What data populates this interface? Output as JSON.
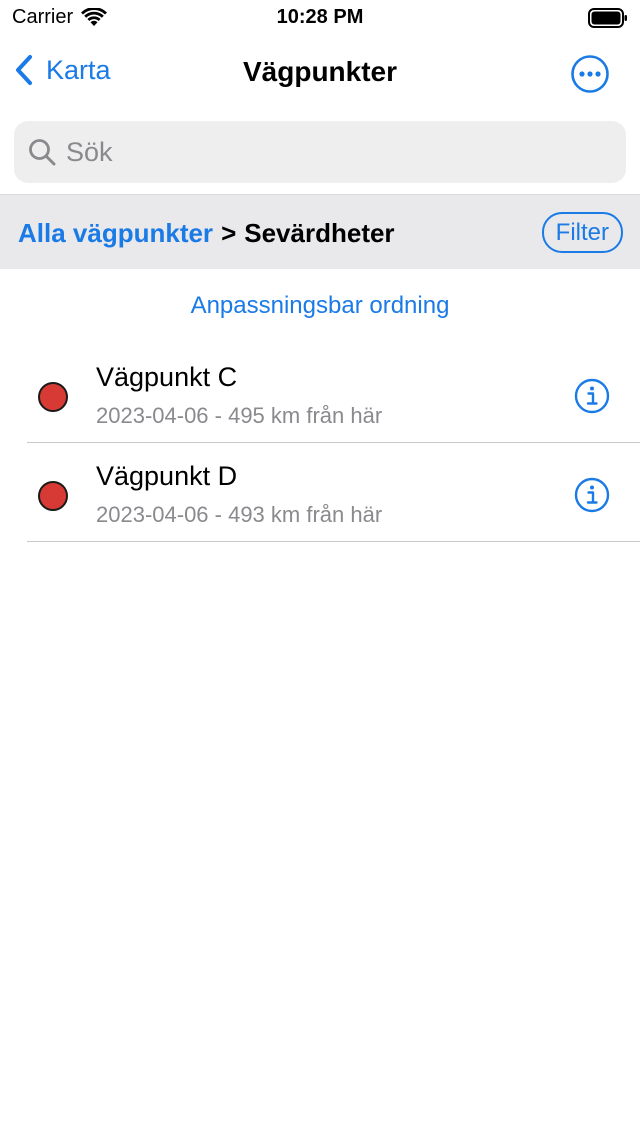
{
  "status_bar": {
    "carrier": "Carrier",
    "time": "10:28 PM",
    "icons": [
      "wifi-icon",
      "battery-icon"
    ]
  },
  "nav": {
    "back_label": "Karta",
    "title": "Vägpunkter",
    "more_icon": "ellipsis-circle-icon"
  },
  "search": {
    "placeholder": "Sök",
    "value": ""
  },
  "filter_bar": {
    "breadcrumb_link": "Alla vägpunkter",
    "separator": ">",
    "current": "Sevärdheter",
    "filter_label": "Filter"
  },
  "sort_order_label": "Anpassningsbar ordning",
  "waypoints": [
    {
      "name": "Vägpunkt C",
      "detail": "2023-04-06 - 495 km från här",
      "color": "#d73a35"
    },
    {
      "name": "Vägpunkt D",
      "detail": "2023-04-06 - 493 km från här",
      "color": "#d73a35"
    }
  ],
  "colors": {
    "accent": "#1a7ae6",
    "secondary_text": "#8a8a8e",
    "search_bg": "#eeeeef",
    "filter_bar_bg": "#e9e9eb"
  }
}
